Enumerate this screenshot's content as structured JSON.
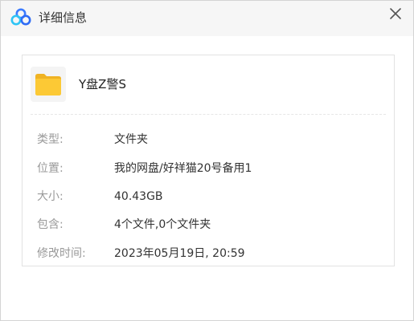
{
  "window": {
    "title": "详细信息",
    "app_icon": "baidu-netdisk-cloud-icon",
    "close_icon": "close-icon"
  },
  "file": {
    "icon": "folder-icon",
    "name": "Y盘Z警S"
  },
  "details": {
    "type": {
      "label": "类型:",
      "value": "文件夹"
    },
    "location": {
      "label": "位置:",
      "value": "我的网盘/好祥猫20号备用1"
    },
    "size": {
      "label": "大小:",
      "value": "40.43GB"
    },
    "contains": {
      "label": "包含:",
      "value": "4个文件,0个文件夹"
    },
    "modified": {
      "label": "修改时间:",
      "value": "2023年05月19日, 20:59"
    }
  },
  "colors": {
    "titlebar_bg": "#f6f6f6",
    "label_text": "#999999",
    "value_text": "#333333",
    "folder_yellow": "#fcc935",
    "logo_blue": "#3b7bff",
    "logo_cyan": "#2ec4f5"
  }
}
